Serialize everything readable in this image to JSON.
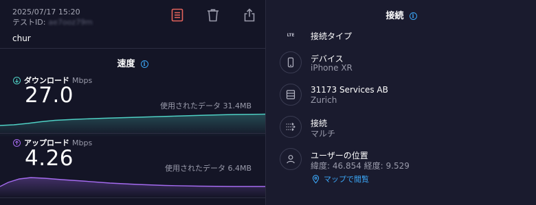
{
  "result": {
    "datetime": "2025/07/17 15:20",
    "test_id_label": "テストID:",
    "test_id_value": "ae7ooz79m",
    "server": "chur"
  },
  "toolbar": {
    "icons": [
      "results-list-icon",
      "trash-icon",
      "share-icon"
    ],
    "active_color": "#e5645c"
  },
  "speed": {
    "title": "速度",
    "download": {
      "label": "ダウンロード",
      "unit": "Mbps",
      "value": "27.0",
      "used_data": "使用されたデータ 31.4MB",
      "color": "#4fd1c5"
    },
    "upload": {
      "label": "アップロード",
      "unit": "Mbps",
      "value": "4.26",
      "used_data": "使用されたデータ 6.4MB",
      "color": "#a56bf0"
    }
  },
  "connection": {
    "title": "接続",
    "rows": [
      {
        "icon": "lte-icon",
        "icon_text": "LTE",
        "title": "接続タイプ",
        "subtitle": ""
      },
      {
        "icon": "phone-icon",
        "title": "デバイス",
        "subtitle": "iPhone XR"
      },
      {
        "icon": "server-icon",
        "title": "31173 Services AB",
        "subtitle": "Zurich"
      },
      {
        "icon": "connections-icon",
        "title": "接続",
        "subtitle": "マルチ"
      },
      {
        "icon": "user-location-icon",
        "title": "ユーザーの位置",
        "subtitle": "緯度: 46.854  経度: 9.529"
      }
    ],
    "map_link": "マップで閲覧"
  },
  "colors": {
    "background": "#141526",
    "panel": "#1a1b2e",
    "accent": "#3ba5f5"
  }
}
